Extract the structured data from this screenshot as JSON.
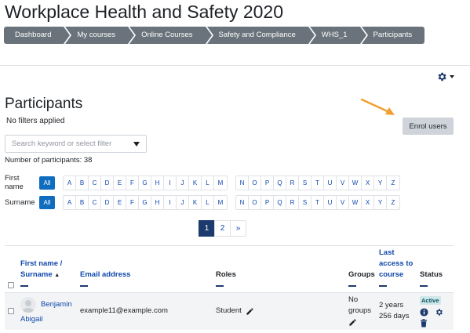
{
  "course": {
    "title": "Workplace Health and Safety 2020"
  },
  "breadcrumb": [
    "Dashboard",
    "My courses",
    "Online Courses",
    "Safety and Compliance",
    "WHS_1",
    "Participants"
  ],
  "page": {
    "heading": "Participants",
    "filters_note": "No filters applied",
    "enrol_label": "Enrol users",
    "search_placeholder": "Search keyword or select filter",
    "participant_count": "Number of participants: 38"
  },
  "initials": {
    "first_name_label": "First name",
    "surname_label": "Surname",
    "all_label": "All",
    "letters_1": [
      "A",
      "B",
      "C",
      "D",
      "E",
      "F",
      "G",
      "H",
      "I",
      "J",
      "K",
      "L",
      "M"
    ],
    "letters_2": [
      "N",
      "O",
      "P",
      "Q",
      "R",
      "S",
      "T",
      "U",
      "V",
      "W",
      "X",
      "Y",
      "Z"
    ]
  },
  "pagination": {
    "pages": [
      "1",
      "2"
    ],
    "next": "»",
    "current": "1"
  },
  "table": {
    "columns": {
      "name_line1": "First name /",
      "name_line2": "Surname",
      "sort_indicator": "▲",
      "email": "Email address",
      "roles": "Roles",
      "groups": "Groups",
      "access_line1": "Last",
      "access_line2": "access to",
      "access_line3": "course",
      "status": "Status"
    },
    "rows": [
      {
        "first_name": "Benjamin",
        "surname": "Abigail",
        "email": "example11@example.com",
        "role": "Student",
        "groups_line1": "No",
        "groups_line2": "groups",
        "access_line1": "2 years",
        "access_line2": "256 days",
        "status": "Active"
      }
    ]
  },
  "colors": {
    "breadcrumb_bg": "#6a737b",
    "link": "#0f47ad",
    "active_page": "#1d3a6e",
    "annotation_arrow": "#f0a030"
  },
  "icons": [
    "gear-icon",
    "pencil-icon",
    "info-icon",
    "trash-icon",
    "annotation-arrow"
  ]
}
